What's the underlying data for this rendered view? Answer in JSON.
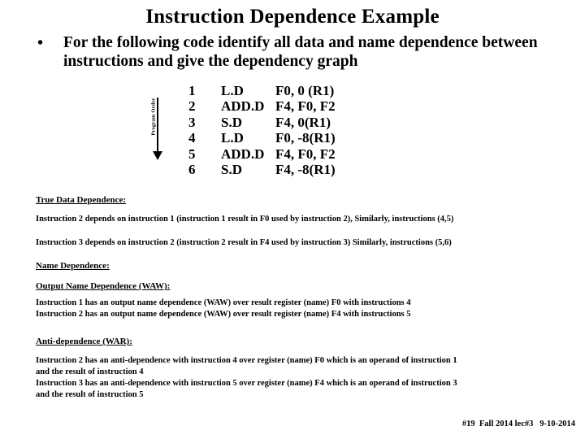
{
  "slide": {
    "title": "Instruction Dependence Example",
    "bullet": {
      "marker": "•",
      "text": "For the following code identify all data and name dependence between instructions and give the dependency graph"
    },
    "program_order_label": "Program Order",
    "code_listing": {
      "rows": [
        {
          "num": "1",
          "op": "L.D",
          "args": "F0, 0 (R1)"
        },
        {
          "num": "2",
          "op": "ADD.D",
          "args": "F4, F0, F2"
        },
        {
          "num": "3",
          "op": "S.D",
          "args": "F4, 0(R1)"
        },
        {
          "num": "4",
          "op": "L.D",
          "args": "F0, -8(R1)"
        },
        {
          "num": "5",
          "op": "ADD.D",
          "args": "F4, F0, F2"
        },
        {
          "num": "6",
          "op": "S.D",
          "args": "F4, -8(R1)"
        }
      ]
    },
    "sections": {
      "true_data": {
        "heading": "True Data Dependence:",
        "line1": "Instruction 2   depends on instruction  1   (instruction 1 result in F0 used by instruction 2),   Similarly,  instructions (4,5)",
        "line2": "Instruction 3  depends on instruction  2   (instruction 2 result in F4 used by instruction 3)  Similarly,  instructions (5,6)"
      },
      "name_dependence": {
        "heading": "Name Dependence:",
        "waw": {
          "heading": "Output Name Dependence (WAW):",
          "line1": "Instruction 1  has an output name dependence (WAW)  over result register (name)  F0  with instructions   4",
          "line2": "Instruction 2  has an output name dependence (WAW)  over result register (name)  F4  with instructions   5"
        },
        "war": {
          "heading": "Anti-dependence (WAR):",
          "line1": "Instruction 2   has an anti-dependence  with  instruction  4   over register (name)  F0  which is an operand of instruction 1",
          "line2": "and  the result of instruction 4",
          "line3": "Instruction 3   has an anti-dependence  with  instruction  5   over register (name)  F4  which is an operand of instruction 3",
          "line4": "and  the result of instruction 5"
        }
      }
    },
    "footer": "#19  Fall 2014 lec#3   9-10-2014"
  }
}
